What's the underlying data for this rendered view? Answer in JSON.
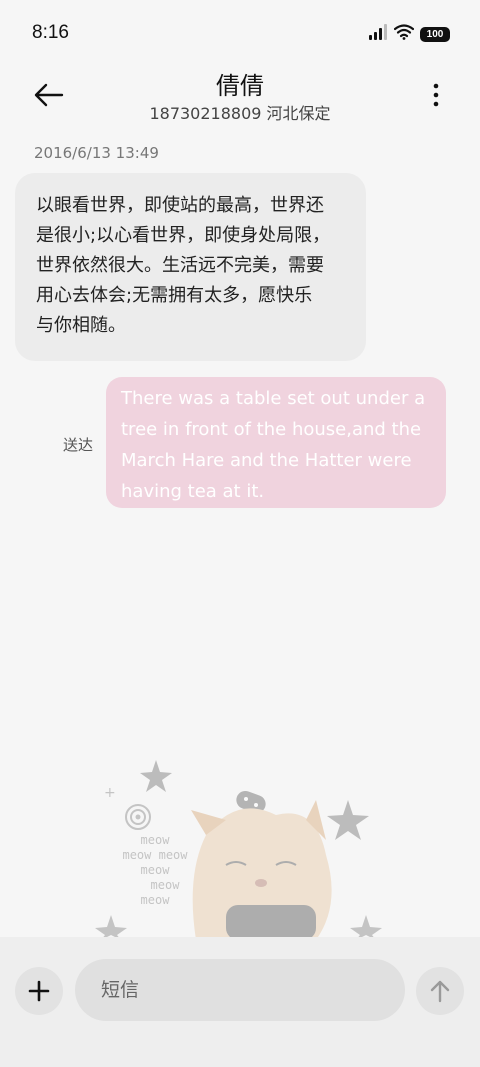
{
  "status_bar": {
    "time": "8:16",
    "battery": "100",
    "icons": [
      "signal-icon",
      "wifi-icon",
      "battery-icon"
    ]
  },
  "header": {
    "back_icon": "arrow-left-icon",
    "title": "倩倩",
    "subtitle": "18730218809 河北保定",
    "more_icon": "more-vertical-icon"
  },
  "conversation": {
    "timestamp": "2016/6/13 13:49",
    "incoming": {
      "lines": [
        "以眼看世界，即使站的最高，世界还",
        "是很小;以心看世界，即使身处局限，",
        "世界依然很大。生活远不完美，需要",
        "用心去体会;无需拥有太多，愿快乐",
        "与你相随。"
      ]
    },
    "outgoing": {
      "status": "送达",
      "lines": [
        "There was a table set out under a",
        "tree in front of the house,and the",
        "March Hare and the Hatter were",
        "having tea at it."
      ]
    }
  },
  "sticker": {
    "words": [
      "meow",
      "meow meow",
      "meow",
      "meow",
      "meow"
    ]
  },
  "composer": {
    "add_icon": "plus-icon",
    "placeholder": "短信",
    "send_icon": "arrow-up-icon"
  },
  "colors": {
    "background": "#f6f6f6",
    "incoming_bubble": "#ececec",
    "outgoing_bubble": "#f0d3de"
  }
}
